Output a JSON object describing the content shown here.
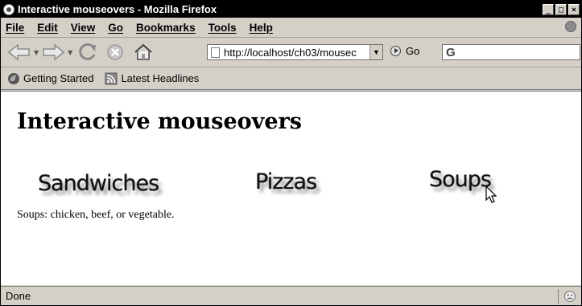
{
  "window": {
    "title": "Interactive mouseovers - Mozilla Firefox"
  },
  "window_controls": {
    "minimize": "_",
    "maximize": "□",
    "close": "×"
  },
  "menubar": {
    "items": [
      {
        "label": "File"
      },
      {
        "label": "Edit"
      },
      {
        "label": "View"
      },
      {
        "label": "Go"
      },
      {
        "label": "Bookmarks"
      },
      {
        "label": "Tools"
      },
      {
        "label": "Help"
      }
    ]
  },
  "toolbar": {
    "url": "http://localhost/ch03/mousec",
    "go_label": "Go",
    "search_icon": "google-g-icon"
  },
  "bookmarks": [
    {
      "label": "Getting Started",
      "icon": "firefox-icon"
    },
    {
      "label": "Latest Headlines",
      "icon": "rss-feed-icon"
    }
  ],
  "page": {
    "heading": "Interactive mouseovers",
    "images": [
      {
        "label": "Sandwiches"
      },
      {
        "label": "Pizzas"
      },
      {
        "label": "Soups"
      }
    ],
    "description": "Soups: chicken, beef, or vegetable."
  },
  "status": {
    "text": "Done"
  }
}
